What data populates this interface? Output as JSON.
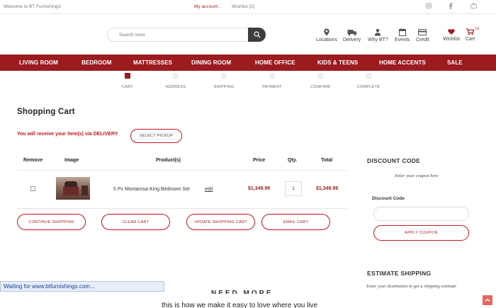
{
  "topbar": {
    "welcome": "Welcome to BT Furnishings!",
    "my_account": "My account",
    "wishlist": "Wishlist (2)"
  },
  "header": {
    "search_placeholder": "Search store",
    "icons": [
      {
        "label": "Locations",
        "icon": "location-pin-icon"
      },
      {
        "label": "Delivery",
        "icon": "truck-icon"
      },
      {
        "label": "Why BT?",
        "icon": "person-icon"
      },
      {
        "label": "Events",
        "icon": "calendar-icon"
      },
      {
        "label": "Credit",
        "icon": "credit-card-icon"
      },
      {
        "label": "Wishlist",
        "icon": "heart-icon"
      },
      {
        "label": "Cart",
        "icon": "cart-icon",
        "count": "(1)"
      }
    ]
  },
  "nav": [
    "LIVING ROOM",
    "BEDROOM",
    "MATTRESSES",
    "DINING ROOM",
    "HOME OFFICE",
    "KIDS & TEENS",
    "HOME ACCENTS",
    "SALE"
  ],
  "steps": [
    "CART",
    "ADDRESS",
    "SHIPPING",
    "PAYMENT",
    "CONFIRM",
    "COMPLETE"
  ],
  "page_title": "Shopping Cart",
  "delivery_notice": "You will receive your item(s) via DELIVERY",
  "select_pickup": "SELECT PICKUP",
  "table": {
    "headers": [
      "Remove",
      "Image",
      "Product(s)",
      "Price",
      "Qty.",
      "Total"
    ],
    "rows": [
      {
        "product": "5 Pc Montarosa King Bedroom Set",
        "edit": "edit",
        "price": "$1,349.99",
        "qty": "1",
        "total": "$1,349.99"
      }
    ]
  },
  "buttons": {
    "continue": "CONTINUE SHOPPING",
    "clear": "CLEAR CART",
    "update": "UPDATE SHOPPING CART",
    "email": "EMAIL CART"
  },
  "discount": {
    "heading": "DISCOUNT CODE",
    "note": "Enter your coupon here",
    "label": "Discount Code",
    "apply": "APPLY COUPON"
  },
  "shipping": {
    "heading": "ESTIMATE SHIPPING",
    "note": "Enter your destination to get a shipping estimate"
  },
  "status_bar": "Waiting for www.btfurnishings.com...",
  "partial_text": {
    "heading_fragment": "NEED MORE",
    "line": "this is how we make it easy to love where you live"
  },
  "colors": {
    "brand": "#9b1b1e",
    "accent_red": "#c0181e",
    "status_bg": "#e6eefa"
  }
}
